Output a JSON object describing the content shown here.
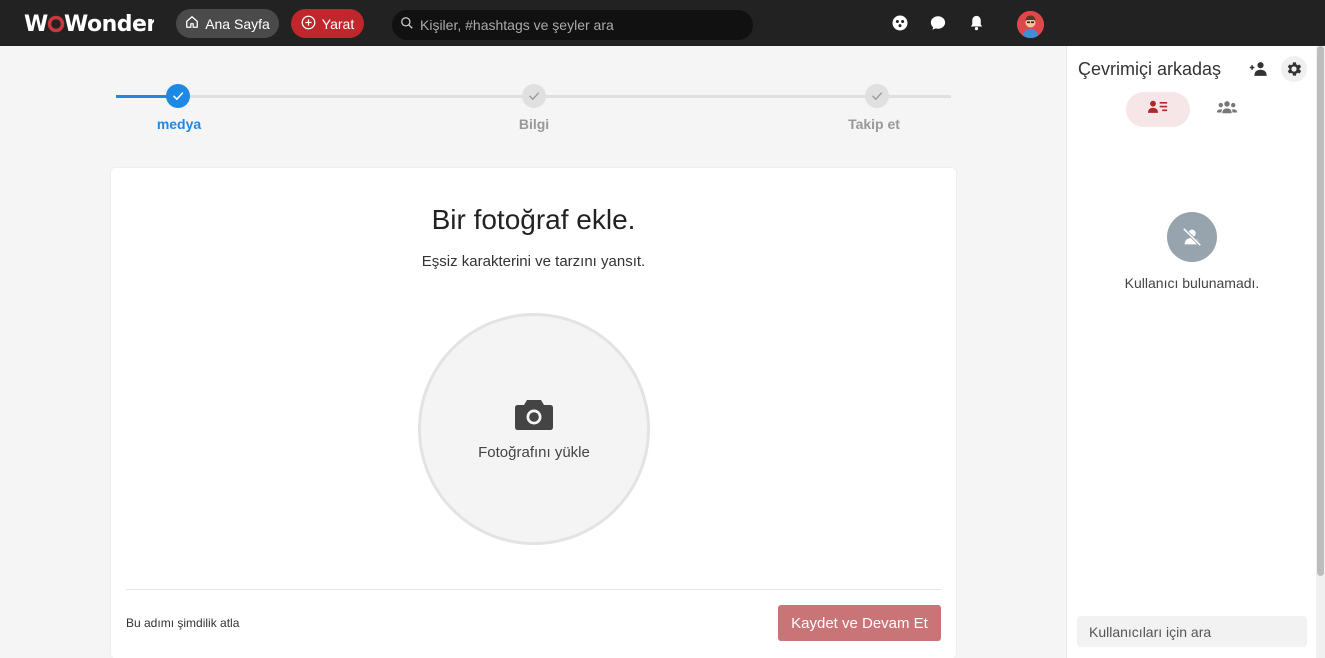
{
  "header": {
    "logo": "WoWonder",
    "home_label": "Ana Sayfa",
    "create_label": "Yarat",
    "search_placeholder": "Kişiler, #hashtags ve şeyler ara"
  },
  "stepper": {
    "steps": [
      {
        "label": "medya",
        "state": "active"
      },
      {
        "label": "Bilgi",
        "state": "pending"
      },
      {
        "label": "Takip et",
        "state": "pending"
      }
    ],
    "active_color": "#1e88e5"
  },
  "card": {
    "title": "Bir fotoğraf ekle.",
    "subtitle": "Eşsiz karakterini ve tarzını yansıt.",
    "upload_label": "Fotoğrafını yükle",
    "skip_label": "Bu adımı şimdilik atla",
    "save_label": "Kaydet ve Devam Et"
  },
  "sidebar": {
    "title": "Çevrimiçi arkadaş",
    "empty_text": "Kullanıcı bulunamadı.",
    "search_placeholder": "Kullanıcıları için ara"
  },
  "colors": {
    "brand_red": "#c0272d",
    "save_button": "#c97476",
    "header_bg": "#222222"
  }
}
